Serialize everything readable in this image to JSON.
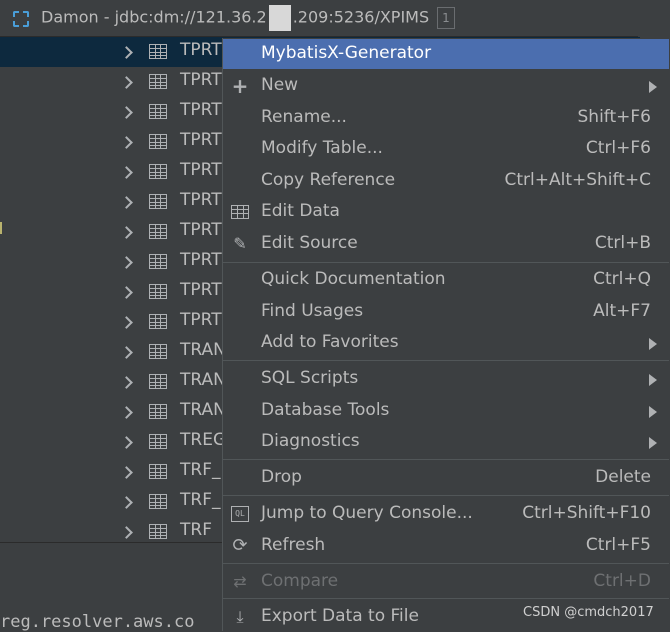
{
  "titlebar": {
    "prefix": "Damon - jdbc:dm://121.36.2",
    "suffix": ".209:5236/XPIMS",
    "badge": "1",
    "icon": "database-icon"
  },
  "tree": {
    "rows": [
      {
        "label": "TPRT"
      },
      {
        "label": "TPRT"
      },
      {
        "label": "TPRT"
      },
      {
        "label": "TPRT"
      },
      {
        "label": "TPRT"
      },
      {
        "label": "TPRT"
      },
      {
        "label": "TPRT"
      },
      {
        "label": "TPRT"
      },
      {
        "label": "TPRT"
      },
      {
        "label": "TPRT"
      },
      {
        "label": "TRAN"
      },
      {
        "label": "TRAN"
      },
      {
        "label": "TRAN"
      },
      {
        "label": "TREG"
      },
      {
        "label": "TRF_"
      },
      {
        "label": "TRF_"
      },
      {
        "label": "TRF"
      }
    ]
  },
  "console": {
    "text": "reg.resolver.aws.co"
  },
  "menu": {
    "items": [
      {
        "label": "MybatisX-Generator",
        "shortcut": ""
      },
      {
        "label": "New",
        "shortcut": ""
      },
      {
        "label": "Rename...",
        "shortcut": "Shift+F6"
      },
      {
        "label": "Modify Table...",
        "shortcut": "Ctrl+F6"
      },
      {
        "label": "Copy Reference",
        "shortcut": "Ctrl+Alt+Shift+C"
      },
      {
        "label": "Edit Data",
        "shortcut": ""
      },
      {
        "label": "Edit Source",
        "shortcut": "Ctrl+B"
      },
      {
        "label": "Quick Documentation",
        "shortcut": "Ctrl+Q"
      },
      {
        "label": "Find Usages",
        "shortcut": "Alt+F7"
      },
      {
        "label": "Add to Favorites",
        "shortcut": ""
      },
      {
        "label": "SQL Scripts",
        "shortcut": ""
      },
      {
        "label": "Database Tools",
        "shortcut": ""
      },
      {
        "label": "Diagnostics",
        "shortcut": ""
      },
      {
        "label": "Drop",
        "shortcut": "Delete"
      },
      {
        "label": "Jump to Query Console...",
        "shortcut": "Ctrl+Shift+F10"
      },
      {
        "label": "Refresh",
        "shortcut": "Ctrl+F5"
      },
      {
        "label": "Compare",
        "shortcut": "Ctrl+D"
      },
      {
        "label": "Export Data to File",
        "shortcut": ""
      }
    ],
    "ql_icon_text": "QL"
  },
  "watermark": "CSDN @cmdch2017",
  "colors": {
    "highlight": "#4b6eaf",
    "background": "#3c3f41",
    "selected_row": "#0d293e"
  }
}
